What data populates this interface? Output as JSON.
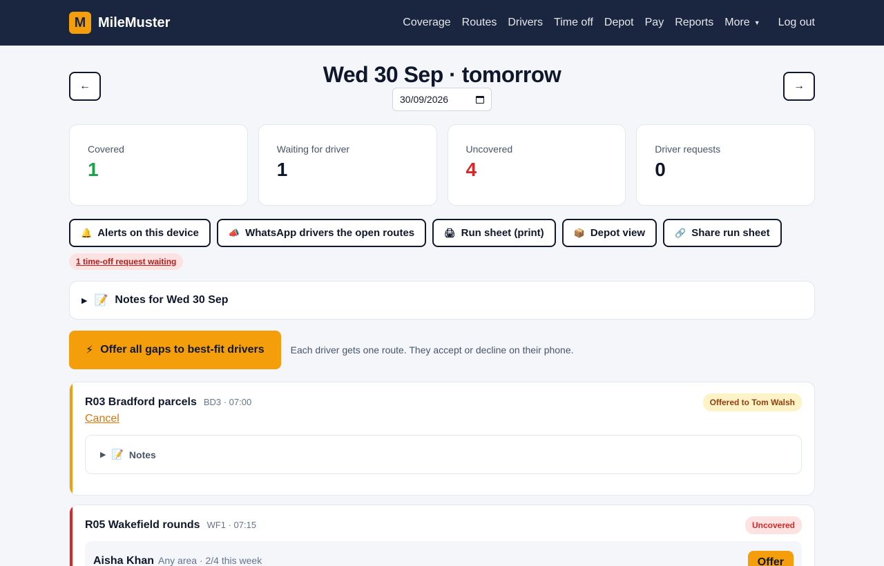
{
  "brand": {
    "logo_letter": "M",
    "name": "MileMuster"
  },
  "nav": {
    "items": [
      "Coverage",
      "Routes",
      "Drivers",
      "Time off",
      "Depot",
      "Pay",
      "Reports"
    ],
    "more": "More",
    "logout": "Log out"
  },
  "date": {
    "prev": "←",
    "next": "→",
    "title": "Wed 30 Sep · tomorrow",
    "input_value": "30/09/2026"
  },
  "stats": [
    {
      "label": "Covered",
      "value": "1",
      "color": "#16a34a"
    },
    {
      "label": "Waiting for driver",
      "value": "1",
      "color": "#0f172a"
    },
    {
      "label": "Uncovered",
      "value": "4",
      "color": "#dc2626"
    },
    {
      "label": "Driver requests",
      "value": "0",
      "color": "#0f172a"
    }
  ],
  "actions": [
    {
      "icon": "🔔",
      "icon_name": "bell-icon",
      "label": "Alerts on this device"
    },
    {
      "icon": "📣",
      "icon_name": "megaphone-icon",
      "label": "WhatsApp drivers the open routes"
    },
    {
      "icon": "🖨",
      "icon_name": "printer-icon",
      "label": "Run sheet (print)"
    },
    {
      "icon": "📦",
      "icon_name": "package-icon",
      "label": "Depot view"
    },
    {
      "icon": "🔗",
      "icon_name": "link-icon",
      "label": "Share run sheet"
    }
  ],
  "timeoff_link": "1 time-off request waiting",
  "day_notes": {
    "icon": "📝",
    "label": "Notes for Wed 30 Sep"
  },
  "offer_all": {
    "icon": "⚡",
    "label": "Offer all gaps to best-fit drivers",
    "hint": "Each driver gets one route. They accept or decline on their phone."
  },
  "routes": [
    {
      "name": "R03 Bradford parcels",
      "meta": "BD3 · 07:00",
      "badge": "Offered to Tom Walsh",
      "cancel": "Cancel",
      "notes_icon": "📝",
      "notes_label": "Notes"
    },
    {
      "name": "R05 Wakefield rounds",
      "meta": "WF1 · 07:15",
      "badge": "Uncovered",
      "candidate": {
        "name": "Aisha Khan",
        "meta": "Any area · 2/4 this week",
        "offer": "Offer"
      }
    }
  ],
  "colors": {
    "accent": "#f59e0b",
    "nav_bg": "#1a2540",
    "danger": "#dc2626",
    "success": "#16a34a"
  }
}
